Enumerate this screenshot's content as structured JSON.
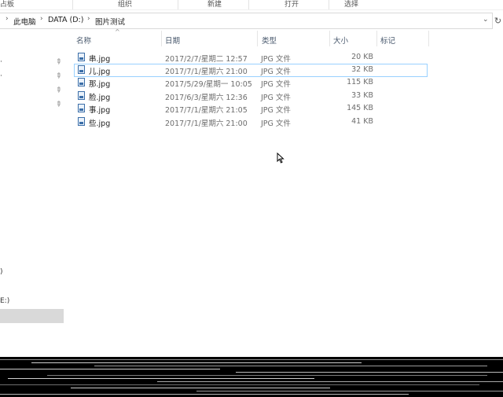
{
  "ribbon": {
    "groups": [
      "占板",
      "组织",
      "新建",
      "打开",
      "选择"
    ]
  },
  "address": {
    "crumbs": [
      "此电脑",
      "DATA (D:)",
      "图片测试"
    ]
  },
  "nav": {
    "fragments": [
      ")",
      "E:)"
    ]
  },
  "columns": [
    "名称",
    "日期",
    "类型",
    "大小",
    "标记"
  ],
  "files": [
    {
      "name": "串.jpg",
      "date": "2017/2/7/星期二 12:57",
      "type": "JPG 文件",
      "size": "20 KB"
    },
    {
      "name": "儿.jpg",
      "date": "2017/7/1/星期六 21:00",
      "type": "JPG 文件",
      "size": "32 KB"
    },
    {
      "name": "那.jpg",
      "date": "2017/5/29/星期一 10:05",
      "type": "JPG 文件",
      "size": "115 KB"
    },
    {
      "name": "脸.jpg",
      "date": "2017/6/3/星期六 12:36",
      "type": "JPG 文件",
      "size": "33 KB"
    },
    {
      "name": "事.jpg",
      "date": "2017/7/1/星期六 21:05",
      "type": "JPG 文件",
      "size": "145 KB"
    },
    {
      "name": "些.jpg",
      "date": "2017/7/1/星期六 21:00",
      "type": "JPG 文件",
      "size": "41 KB"
    }
  ],
  "colors": {
    "accent": "#99d1ff",
    "selection": "#d9d9d9",
    "header_text": "#4a5a6e"
  }
}
